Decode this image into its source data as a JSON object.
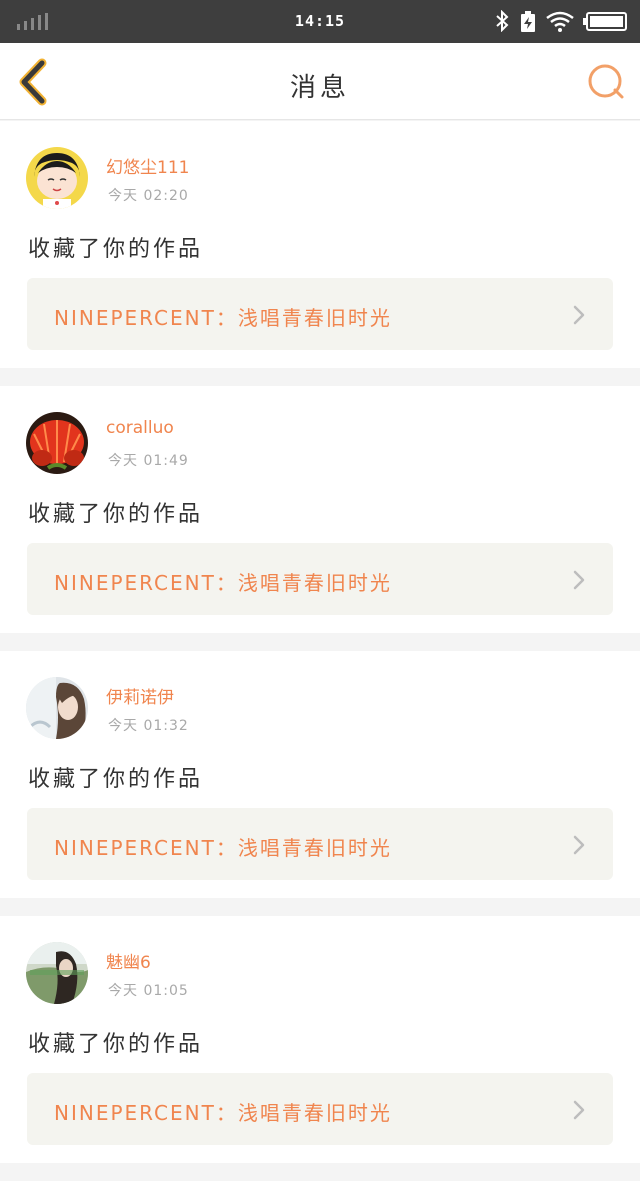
{
  "status_bar": {
    "time": "14:15",
    "icons": [
      "signal-icon",
      "bluetooth-icon",
      "charging-icon",
      "wifi-icon",
      "battery-icon"
    ]
  },
  "nav": {
    "title": "消息",
    "back_icon": "chevron-left-icon",
    "search_icon": "search-icon",
    "accent_color": "#f0854e"
  },
  "messages": [
    {
      "username": "幻悠尘111",
      "time": "今天 02:20",
      "action": "收藏了你的作品",
      "work_title": "NINEPERCENT：浅唱青春旧时光",
      "avatar": "cartoon-girl-avatar"
    },
    {
      "username": "coralluo",
      "time": "今天 01:49",
      "action": "收藏了你的作品",
      "work_title": "NINEPERCENT：浅唱青春旧时光",
      "avatar": "red-cactus-avatar"
    },
    {
      "username": "伊莉诺伊",
      "time": "今天 01:32",
      "action": "收藏了你的作品",
      "work_title": "NINEPERCENT：浅唱青春旧时光",
      "avatar": "girl-photo-avatar"
    },
    {
      "username": "魅幽6",
      "time": "今天 01:05",
      "action": "收藏了你的作品",
      "work_title": "NINEPERCENT：浅唱青春旧时光",
      "avatar": "landscape-photo-avatar"
    }
  ]
}
